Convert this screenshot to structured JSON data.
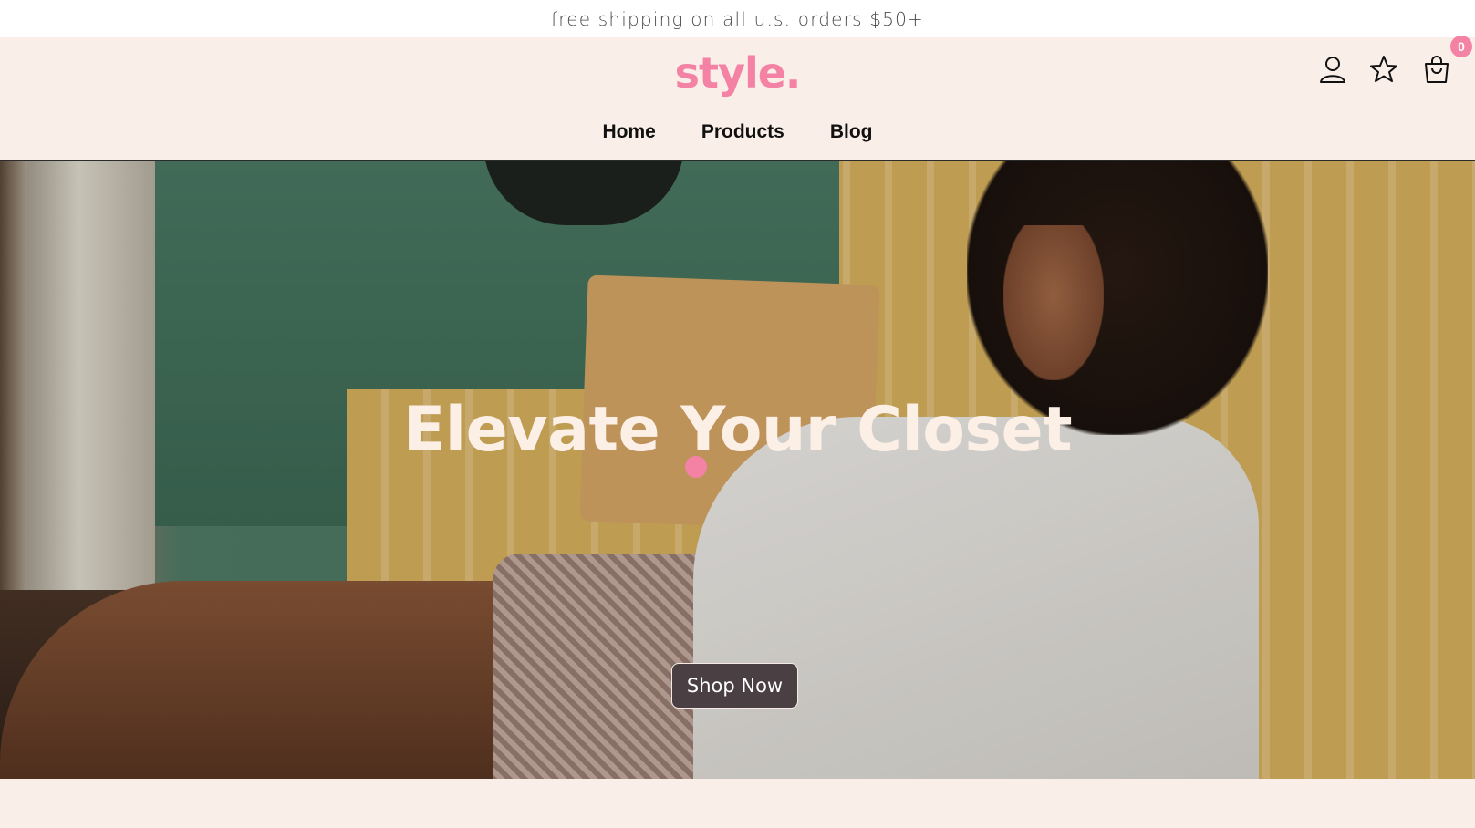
{
  "announcement": {
    "text": "free shipping on all u.s. orders $50+"
  },
  "header": {
    "logo": "style.",
    "nav": [
      {
        "label": "Home"
      },
      {
        "label": "Products"
      },
      {
        "label": "Blog"
      }
    ],
    "icons": {
      "account": "user-icon",
      "wishlist": "star-icon",
      "cart": "shopping-bag-icon"
    },
    "cart_count": "0"
  },
  "hero": {
    "title": "Elevate Your Closet",
    "cta_label": "Shop Now"
  },
  "colors": {
    "brand_pink": "#f382a4",
    "header_bg": "#faeee8",
    "cta_bg": "#4a3f42"
  }
}
